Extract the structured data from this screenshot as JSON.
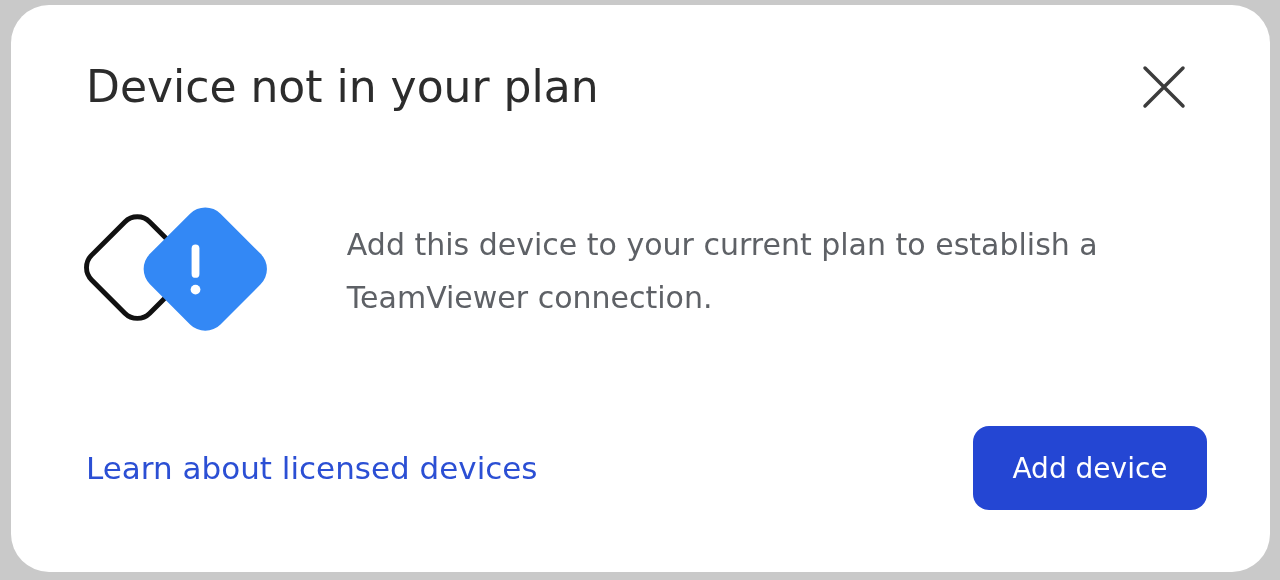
{
  "dialog": {
    "title": "Device not in your plan",
    "message": "Add this device to your current plan to establish a TeamViewer connection.",
    "link": "Learn about licensed devices",
    "button": "Add device"
  }
}
